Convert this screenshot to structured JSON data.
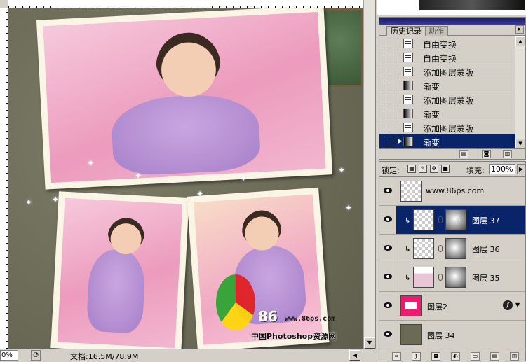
{
  "status_bar": {
    "zoom": "0%",
    "doc_size": "文档:16.5M/78.9M"
  },
  "canvas": {
    "watermark_number": "86",
    "watermark_url": "www.86ps.com",
    "watermark_caption": "中国Photoshop资源网"
  },
  "history": {
    "tabs": [
      {
        "label": "历史记录"
      },
      {
        "label": "动作"
      }
    ],
    "items": [
      {
        "label": "自由变换",
        "icon": "doc-icon"
      },
      {
        "label": "自由变换",
        "icon": "doc-icon"
      },
      {
        "label": "添加图层蒙版",
        "icon": "doc-icon"
      },
      {
        "label": "渐变",
        "icon": "gradient-icon"
      },
      {
        "label": "添加图层蒙版",
        "icon": "doc-icon"
      },
      {
        "label": "渐变",
        "icon": "gradient-icon"
      },
      {
        "label": "添加图层蒙版",
        "icon": "doc-icon"
      },
      {
        "label": "渐变",
        "icon": "gradient-icon",
        "selected": true
      }
    ]
  },
  "layers": {
    "lock_label": "锁定:",
    "fill_label": "填充:",
    "fill_value": "100%",
    "items": [
      {
        "name": "www.86ps.com",
        "thumb": "transparent"
      },
      {
        "name": "图层 37",
        "thumb": "photo-with-mask",
        "selected": true,
        "clipped": true
      },
      {
        "name": "图层 36",
        "thumb": "transparent-with-mask",
        "clipped": true
      },
      {
        "name": "图层 35",
        "thumb": "photo-with-mask",
        "clipped": true
      },
      {
        "name": "图层2",
        "thumb": "pink-frame",
        "fx": true
      },
      {
        "name": "图层 34",
        "thumb": "olive-fill"
      }
    ]
  },
  "colors": {
    "selection": "#0a246a",
    "panel_bg": "#d4d0c8",
    "canvas_bg": "#6f6f5c"
  }
}
